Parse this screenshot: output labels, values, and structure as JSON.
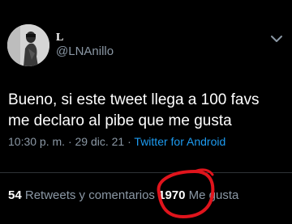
{
  "tweet": {
    "display_name": "L",
    "handle": "@LNAnillo",
    "text": "Bueno, si este tweet llega a 100 favs\nme declaro al pibe que me gusta",
    "time": "10:30 p. m.",
    "separator": "·",
    "date": "29 dic. 21",
    "source": "Twitter for Android"
  },
  "stats": {
    "retweets_count": "54",
    "retweets_label": "Retweets y comentarios",
    "likes_count": "1970",
    "likes_label": "Me gusta"
  },
  "icons": {
    "menu": "chevron-down-icon",
    "avatar": "avatar-photo"
  },
  "colors": {
    "background": "#000000",
    "primary_text": "#ffffff",
    "secondary_text": "#8b98a5",
    "link": "#1d9bf0",
    "annotation": "#e0141c"
  }
}
